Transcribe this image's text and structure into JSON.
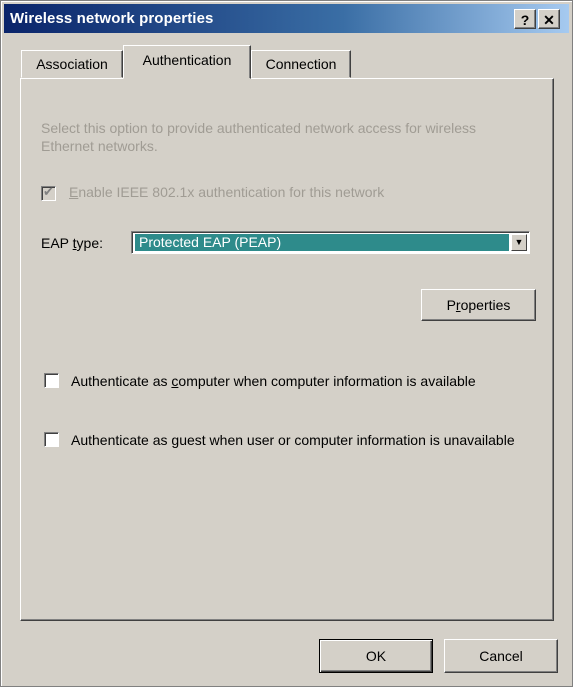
{
  "window": {
    "title": "Wireless network properties",
    "help_label": "?",
    "close_label": "✕"
  },
  "tabs": [
    {
      "label": "Association"
    },
    {
      "label": "Authentication",
      "active": true
    },
    {
      "label": "Connection"
    }
  ],
  "auth": {
    "description": "Select this option to provide authenticated network access for wireless Ethernet networks.",
    "enable_checked": true,
    "enable_label_pre": "",
    "enable_label_accel": "E",
    "enable_label_post": "nable IEEE 802.1x authentication for this network",
    "eap_label_pre": "EAP ",
    "eap_label_accel": "t",
    "eap_label_post": "ype:",
    "eap_value": "Protected EAP (PEAP)",
    "properties_pre": "P",
    "properties_accel": "r",
    "properties_post": "operties",
    "computer_label_pre": "Authenticate as ",
    "computer_label_accel": "c",
    "computer_label_post": "omputer when computer information is available",
    "computer_checked": false,
    "guest_label_pre": "Authenticate as ",
    "guest_label_accel": "g",
    "guest_label_post": "uest when user or computer information is unavailable",
    "guest_checked": false
  },
  "footer": {
    "ok_label": "OK",
    "cancel_label": "Cancel"
  },
  "colors": {
    "title_bar_start": "#0a246a",
    "selection": "#2e8b8b",
    "face": "#d4d0c8"
  }
}
